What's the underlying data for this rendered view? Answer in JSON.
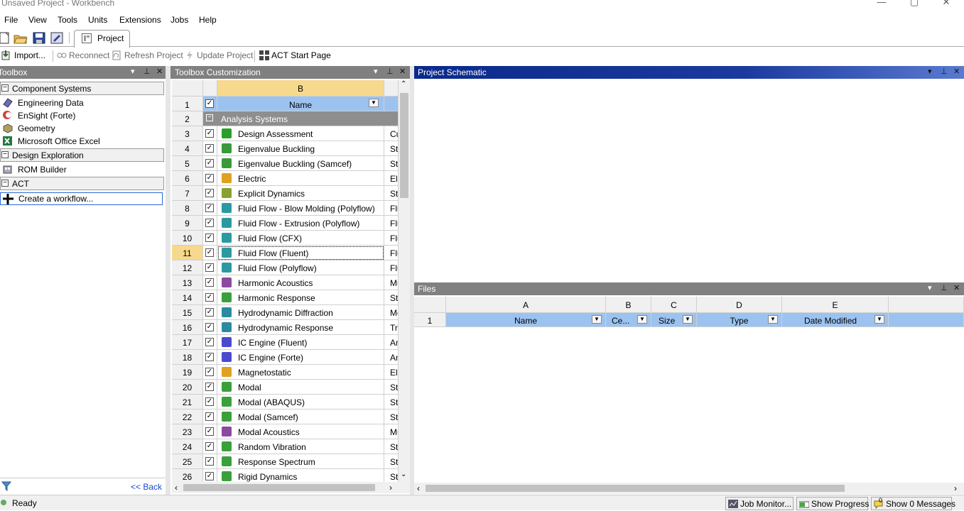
{
  "window": {
    "title": "Unsaved Project - Workbench",
    "min": "—",
    "max": "▢",
    "close": "✕"
  },
  "menu": [
    "File",
    "View",
    "Tools",
    "Units",
    "Extensions",
    "Jobs",
    "Help"
  ],
  "tab": {
    "label": "Project"
  },
  "toolbar": {
    "import": "Import...",
    "reconnect": "Reconnect",
    "refresh": "Refresh Project",
    "update": "Update Project",
    "act_start": "ACT Start Page"
  },
  "toolbox": {
    "title": "Toolbox",
    "groups": [
      {
        "label": "Component Systems",
        "items": [
          "Engineering Data",
          "EnSight (Forte)",
          "Geometry",
          "Microsoft Office Excel"
        ]
      },
      {
        "label": "Design Exploration",
        "items": [
          "ROM Builder"
        ]
      },
      {
        "label": "ACT",
        "items": [
          "Create a workflow..."
        ]
      }
    ],
    "back": "<< Back"
  },
  "customization": {
    "title": "Toolbox Customization",
    "col_b": "B",
    "name_header": "Name",
    "group_label": "Analysis Systems",
    "rows": [
      {
        "n": "3",
        "name": "Design Assessment",
        "c": "Cu",
        "color": "#2aa02a"
      },
      {
        "n": "4",
        "name": "Eigenvalue Buckling",
        "c": "Str",
        "color": "#3a9a3a"
      },
      {
        "n": "5",
        "name": "Eigenvalue Buckling (Samcef)",
        "c": "Str",
        "color": "#3a9a3a"
      },
      {
        "n": "6",
        "name": "Electric",
        "c": "Ele",
        "color": "#e0a020"
      },
      {
        "n": "7",
        "name": "Explicit Dynamics",
        "c": "Str",
        "color": "#8aa030"
      },
      {
        "n": "8",
        "name": "Fluid Flow - Blow Molding (Polyflow)",
        "c": "Flu",
        "color": "#2a9aa0"
      },
      {
        "n": "9",
        "name": "Fluid Flow - Extrusion (Polyflow)",
        "c": "Flu",
        "color": "#2a9aa0"
      },
      {
        "n": "10",
        "name": "Fluid Flow (CFX)",
        "c": "Flu",
        "color": "#2a9aa0"
      },
      {
        "n": "11",
        "name": "Fluid Flow (Fluent)",
        "c": "Flu",
        "color": "#2a9aa0"
      },
      {
        "n": "12",
        "name": "Fluid Flow (Polyflow)",
        "c": "Flu",
        "color": "#2a9aa0"
      },
      {
        "n": "13",
        "name": "Harmonic Acoustics",
        "c": "Mu",
        "color": "#8a4aa0"
      },
      {
        "n": "14",
        "name": "Harmonic Response",
        "c": "Str",
        "color": "#3aa03a"
      },
      {
        "n": "15",
        "name": "Hydrodynamic Diffraction",
        "c": "Mo",
        "color": "#2a8aa0"
      },
      {
        "n": "16",
        "name": "Hydrodynamic Response",
        "c": "Tra",
        "color": "#2a8aa0"
      },
      {
        "n": "17",
        "name": "IC Engine (Fluent)",
        "c": "An",
        "color": "#4a4ad0"
      },
      {
        "n": "18",
        "name": "IC Engine (Forte)",
        "c": "An",
        "color": "#4a4ad0"
      },
      {
        "n": "19",
        "name": "Magnetostatic",
        "c": "Ele",
        "color": "#e0a020"
      },
      {
        "n": "20",
        "name": "Modal",
        "c": "Str",
        "color": "#3aa03a"
      },
      {
        "n": "21",
        "name": "Modal (ABAQUS)",
        "c": "Str",
        "color": "#3aa03a"
      },
      {
        "n": "22",
        "name": "Modal (Samcef)",
        "c": "Str",
        "color": "#3aa03a"
      },
      {
        "n": "23",
        "name": "Modal Acoustics",
        "c": "Mu",
        "color": "#8a4aa0"
      },
      {
        "n": "24",
        "name": "Random Vibration",
        "c": "Str",
        "color": "#3aa03a"
      },
      {
        "n": "25",
        "name": "Response Spectrum",
        "c": "Str",
        "color": "#3aa03a"
      },
      {
        "n": "26",
        "name": "Rigid Dynamics",
        "c": "Str",
        "color": "#3aa03a"
      }
    ]
  },
  "schematic": {
    "title": "Project Schematic"
  },
  "files": {
    "title": "Files",
    "cols": [
      "A",
      "B",
      "C",
      "D",
      "E"
    ],
    "headers": [
      "Name",
      "Ce...",
      "Size",
      "Type",
      "Date Modified"
    ],
    "row1": "1"
  },
  "status": {
    "ready": "Ready",
    "job_monitor": "Job Monitor...",
    "show_progress": "Show Progress",
    "show_messages": "Show 0 Messages",
    "msg_badge": "0"
  },
  "icons": {
    "accent_header": "#0a2a8a",
    "gray_header": "#808080",
    "selection": "#0a64d8"
  }
}
